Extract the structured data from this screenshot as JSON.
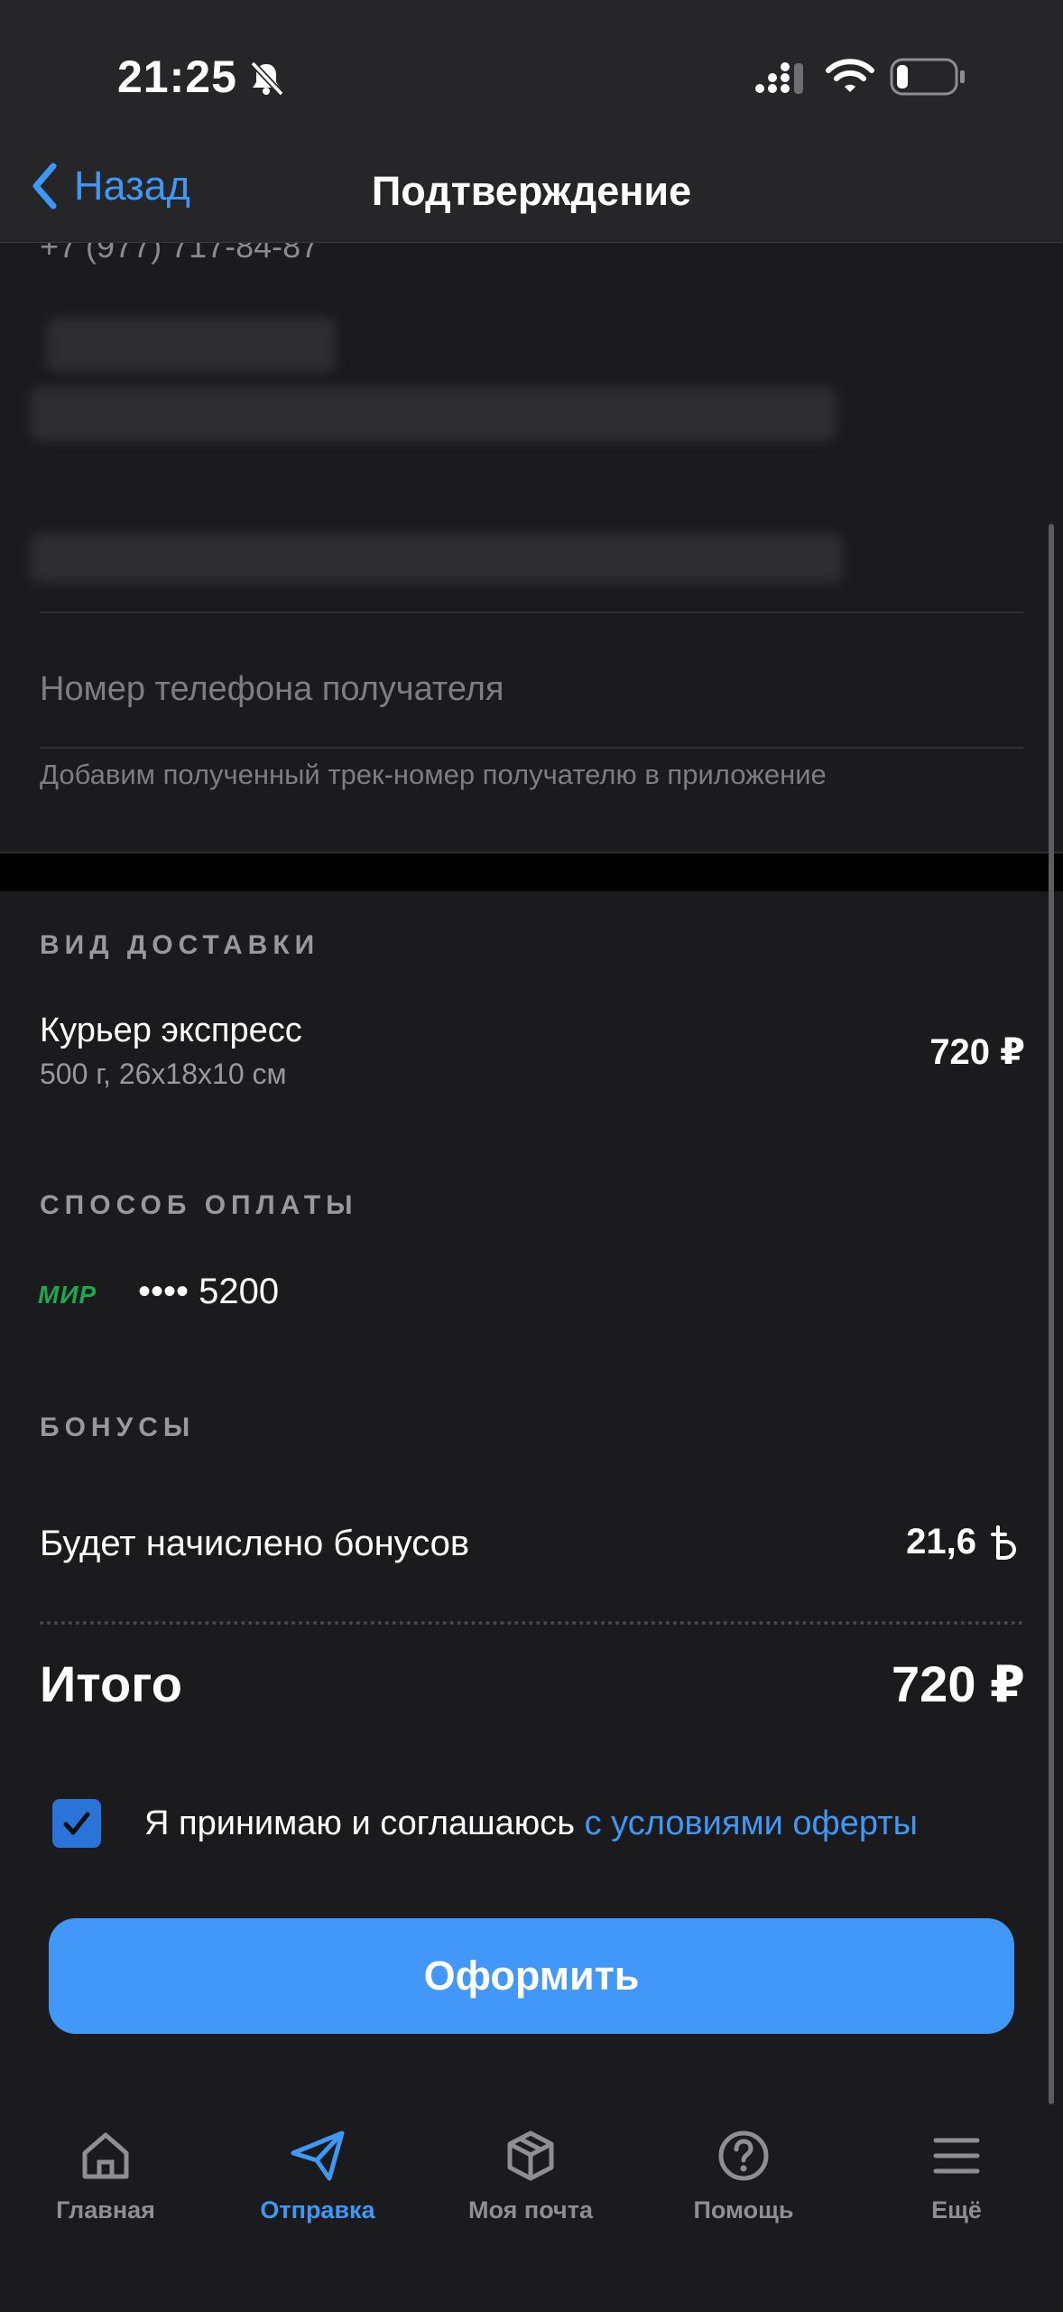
{
  "status_bar": {
    "time": "21:25"
  },
  "nav": {
    "back_label": "Назад",
    "title": "Подтверждение"
  },
  "recipient": {
    "phone_partial": "+7 (977) 717-84-87",
    "phone_placeholder": "Номер телефона получателя",
    "phone_hint": "Добавим полученный трек-номер получателю в приложение"
  },
  "delivery": {
    "section_title": "ВИД ДОСТАВКИ",
    "name": "Курьер экспресс",
    "details": "500 г, 26x18x10 см",
    "price": "720 ₽"
  },
  "payment": {
    "section_title": "СПОСОБ ОПЛАТЫ",
    "card_brand": "МИР",
    "card_masked": "•••• 5200"
  },
  "bonuses": {
    "section_title": "БОНУСЫ",
    "label": "Будет начислено бонусов",
    "value": "21,6"
  },
  "total": {
    "label": "Итого",
    "value": "720 ₽"
  },
  "agreement": {
    "checked": true,
    "text": "Я принимаю и соглашаюсь",
    "link_text": "с условиями оферты"
  },
  "submit_label": "Оформить",
  "tabs": [
    {
      "label": "Главная",
      "icon": "home-icon",
      "active": false
    },
    {
      "label": "Отправка",
      "icon": "paper-plane-icon",
      "active": true
    },
    {
      "label": "Моя почта",
      "icon": "package-icon",
      "active": false
    },
    {
      "label": "Помощь",
      "icon": "help-icon",
      "active": false
    },
    {
      "label": "Ещё",
      "icon": "menu-icon",
      "active": false
    }
  ],
  "colors": {
    "accent": "#3f97f6",
    "button": "#4298f8",
    "background": "#1b1b1d",
    "mir_green": "#1fa64f"
  }
}
